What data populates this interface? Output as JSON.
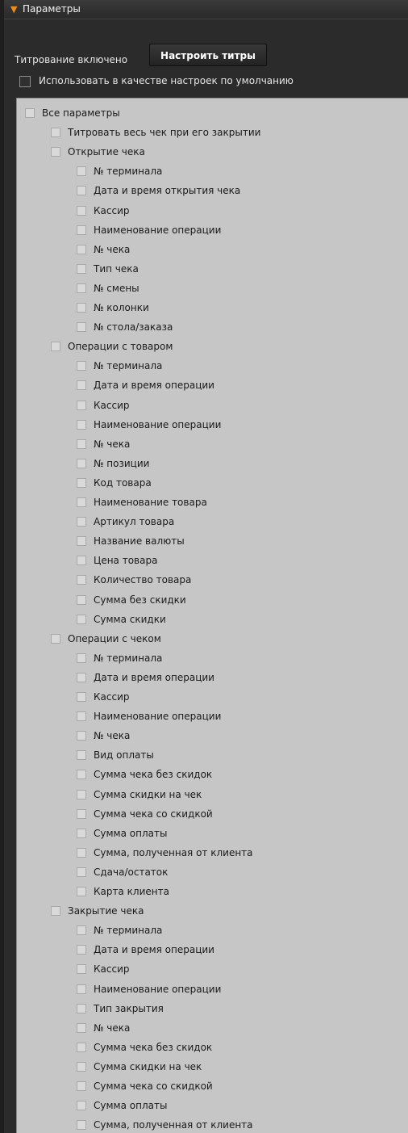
{
  "header": {
    "title": "Параметры"
  },
  "settings": {
    "titling_label": "Титрование включено",
    "configure_button": "Настроить титры",
    "use_default_label": "Использовать в качестве настроек по умолчанию"
  },
  "tree": {
    "root": "Все параметры",
    "items": [
      {
        "level": 1,
        "label": "Титровать весь чек при его закрытии"
      },
      {
        "level": 1,
        "label": "Открытие чека"
      },
      {
        "level": 2,
        "label": "№ терминала"
      },
      {
        "level": 2,
        "label": "Дата и время открытия чека"
      },
      {
        "level": 2,
        "label": "Кассир"
      },
      {
        "level": 2,
        "label": "Наименование операции"
      },
      {
        "level": 2,
        "label": "№ чека"
      },
      {
        "level": 2,
        "label": "Тип чека"
      },
      {
        "level": 2,
        "label": "№ смены"
      },
      {
        "level": 2,
        "label": "№ колонки"
      },
      {
        "level": 2,
        "label": "№ стола/заказа"
      },
      {
        "level": 1,
        "label": "Операции с товаром"
      },
      {
        "level": 2,
        "label": "№ терминала"
      },
      {
        "level": 2,
        "label": "Дата и время операции"
      },
      {
        "level": 2,
        "label": "Кассир"
      },
      {
        "level": 2,
        "label": "Наименование операции"
      },
      {
        "level": 2,
        "label": "№ чека"
      },
      {
        "level": 2,
        "label": "№ позиции"
      },
      {
        "level": 2,
        "label": "Код товара"
      },
      {
        "level": 2,
        "label": "Наименование товара"
      },
      {
        "level": 2,
        "label": "Артикул товара"
      },
      {
        "level": 2,
        "label": "Название валюты"
      },
      {
        "level": 2,
        "label": "Цена товара"
      },
      {
        "level": 2,
        "label": "Количество товара"
      },
      {
        "level": 2,
        "label": "Сумма без скидки"
      },
      {
        "level": 2,
        "label": "Сумма скидки"
      },
      {
        "level": 1,
        "label": "Операции с чеком"
      },
      {
        "level": 2,
        "label": "№ терминала"
      },
      {
        "level": 2,
        "label": "Дата и время операции"
      },
      {
        "level": 2,
        "label": "Кассир"
      },
      {
        "level": 2,
        "label": "Наименование операции"
      },
      {
        "level": 2,
        "label": "№ чека"
      },
      {
        "level": 2,
        "label": "Вид оплаты"
      },
      {
        "level": 2,
        "label": "Сумма чека без скидок"
      },
      {
        "level": 2,
        "label": "Сумма скидки на чек"
      },
      {
        "level": 2,
        "label": "Сумма чека со скидкой"
      },
      {
        "level": 2,
        "label": "Сумма оплаты"
      },
      {
        "level": 2,
        "label": "Сумма, полученная от клиента"
      },
      {
        "level": 2,
        "label": "Сдача/остаток"
      },
      {
        "level": 2,
        "label": "Карта клиента"
      },
      {
        "level": 1,
        "label": "Закрытие чека"
      },
      {
        "level": 2,
        "label": "№ терминала"
      },
      {
        "level": 2,
        "label": "Дата и время операции"
      },
      {
        "level": 2,
        "label": "Кассир"
      },
      {
        "level": 2,
        "label": "Наименование операции"
      },
      {
        "level": 2,
        "label": "Тип закрытия"
      },
      {
        "level": 2,
        "label": "№ чека"
      },
      {
        "level": 2,
        "label": "Сумма чека без скидок"
      },
      {
        "level": 2,
        "label": "Сумма скидки на чек"
      },
      {
        "level": 2,
        "label": "Сумма чека со скидкой"
      },
      {
        "level": 2,
        "label": "Сумма оплаты"
      },
      {
        "level": 2,
        "label": "Сумма, полученная от клиента"
      }
    ]
  }
}
